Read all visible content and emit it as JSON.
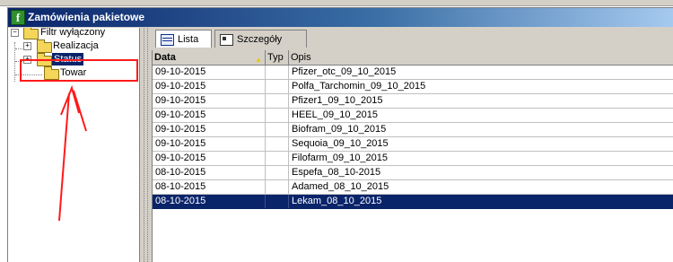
{
  "window": {
    "title": "Zamówienia pakietowe",
    "icon": "f-app-icon"
  },
  "tree": {
    "root_label": "Filtr wyłączony",
    "items": [
      {
        "label": "Realizacja",
        "selected": false
      },
      {
        "label": "Status",
        "selected": true
      },
      {
        "label": "Towar",
        "selected": false
      }
    ]
  },
  "tabs": [
    {
      "label": "Lista",
      "active": true
    },
    {
      "label": "Szczegóły",
      "active": false
    }
  ],
  "grid": {
    "columns": [
      "Data",
      "Typ",
      "Opis"
    ],
    "rows": [
      {
        "data": "09-10-2015",
        "typ": "",
        "opis": "Pfizer_otc_09_10_2015"
      },
      {
        "data": "09-10-2015",
        "typ": "",
        "opis": "Polfa_Tarchomin_09_10_2015"
      },
      {
        "data": "09-10-2015",
        "typ": "",
        "opis": "Pfizer1_09_10_2015"
      },
      {
        "data": "09-10-2015",
        "typ": "",
        "opis": "HEEL_09_10_2015"
      },
      {
        "data": "09-10-2015",
        "typ": "",
        "opis": "Biofram_09_10_2015"
      },
      {
        "data": "09-10-2015",
        "typ": "",
        "opis": "Sequoia_09_10_2015"
      },
      {
        "data": "09-10-2015",
        "typ": "",
        "opis": "Filofarm_09_10_2015"
      },
      {
        "data": "08-10-2015",
        "typ": "",
        "opis": "Espefa_08_10-2015"
      },
      {
        "data": "08-10-2015",
        "typ": "",
        "opis": "Adamed_08_10_2015"
      },
      {
        "data": "08-10-2015",
        "typ": "",
        "opis": "Lekam_08_10_2015",
        "selected": true
      }
    ]
  },
  "colors": {
    "annotation": "#ff1a1a",
    "selection": "#0a246a",
    "title_bar": "#0a246a"
  }
}
